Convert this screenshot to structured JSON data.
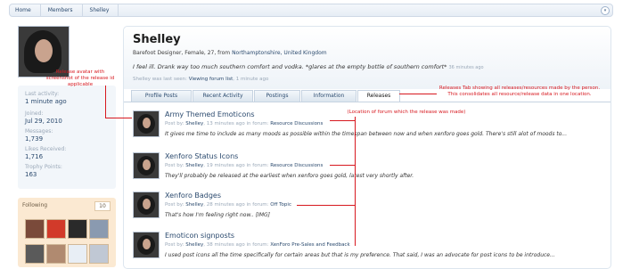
{
  "breadcrumb": {
    "items": [
      "Home",
      "Members",
      "Shelley"
    ]
  },
  "sidebar": {
    "stats": [
      {
        "label": "Last activity:",
        "value": "1 minute ago"
      },
      {
        "label": "Joined:",
        "value": "Jul 29, 2010"
      },
      {
        "label": "Messages:",
        "value": "1,739"
      },
      {
        "label": "Likes Received:",
        "value": "1,716"
      },
      {
        "label": "Trophy Points:",
        "value": "163"
      }
    ],
    "following": {
      "label": "Following",
      "count": "10"
    }
  },
  "profile": {
    "name": "Shelley",
    "title": "Barefoot Designer, Female, 27, from ",
    "location": "Northamptonshire, United Kingdom",
    "status": "I feel ill. Drank way too much southern comfort and vodka. *glares at the empty bottle of southern comfort* ",
    "status_time": "36 minutes ago",
    "lastseen_prefix": "Shelley was last seen: ",
    "lastseen_activity": "Viewing forum list",
    "lastseen_time": ", 1 minute ago"
  },
  "tabs": [
    {
      "label": "Profile Posts"
    },
    {
      "label": "Recent Activity"
    },
    {
      "label": "Postings"
    },
    {
      "label": "Information"
    },
    {
      "label": "Releases"
    }
  ],
  "releases": [
    {
      "title": "Army Themed Emoticons",
      "by": "Post by: ",
      "author": "Shelley",
      "time": ", 13 minutes ago in forum: ",
      "forum": "Resource Discussions",
      "snippet": "It gives me time to include as many moods as possible within the timespan between now and when xenforo goes gold. There's still alot of moods to..."
    },
    {
      "title": "Xenforo Status Icons",
      "by": "Post by: ",
      "author": "Shelley",
      "time": ", 19 minutes ago in forum: ",
      "forum": "Resource Discussions",
      "snippet": "They'll probably be released at the earliest when xenforo goes gold, latest very shortly after."
    },
    {
      "title": "Xenforo Badges",
      "by": "Post by: ",
      "author": "Shelley",
      "time": ", 28 minutes ago in forum: ",
      "forum": "Off Topic",
      "snippet": "That's how I'm feeling right now.. [IMG]"
    },
    {
      "title": "Emoticon signposts",
      "by": "Post by: ",
      "author": "Shelley",
      "time": ", 38 minutes ago in forum: ",
      "forum": "XenForo Pre-Sales and Feedback",
      "snippet": "I used post icons all the time specifically for certain areas but that is my preference. That said, I was an advocate for post icons to be introduce..."
    }
  ],
  "annotations": {
    "avatar": "Release avatar with screenshot of the release id applicable",
    "tab": "Releases Tab showing all releases/resources made by the person. This consolidates all resource/release data in one location.",
    "forum": "(Location of forum which the release was made)"
  },
  "colors": {
    "link": "#2b4a6e",
    "annotation": "#d7181f",
    "following_bg": "#fbe9d2"
  }
}
